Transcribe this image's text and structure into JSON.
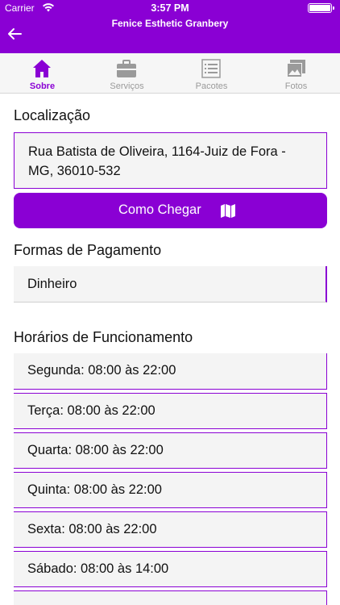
{
  "status": {
    "carrier": "Carrier",
    "time": "3:57 PM"
  },
  "header": {
    "title": "Fenice Esthetic Granbery"
  },
  "tabs": [
    {
      "label": "Sobre",
      "icon": "home-icon",
      "active": true
    },
    {
      "label": "Serviços",
      "icon": "briefcase-icon",
      "active": false
    },
    {
      "label": "Pacotes",
      "icon": "list-icon",
      "active": false
    },
    {
      "label": "Fotos",
      "icon": "photos-icon",
      "active": false
    }
  ],
  "location": {
    "title": "Localização",
    "address_line1": "Rua Batista de Oliveira, 1164-Juiz de Fora -",
    "address_line2": "MG, 36010-532",
    "directions_button": "Como Chegar"
  },
  "payment": {
    "title": "Formas de Pagamento",
    "methods": [
      "Dinheiro"
    ]
  },
  "hours": {
    "title": "Horários de Funcionamento",
    "items": [
      "Segunda: 08:00 às 22:00",
      "Terça: 08:00 às 22:00",
      "Quarta: 08:00 às 22:00",
      "Quinta: 08:00 às 22:00",
      "Sexta: 08:00 às 22:00",
      "Sábado: 08:00 às 14:00"
    ]
  },
  "colors": {
    "accent": "#8a00d4",
    "box_bg": "#f4f4f4",
    "inactive_tab": "#9a9a9a"
  }
}
